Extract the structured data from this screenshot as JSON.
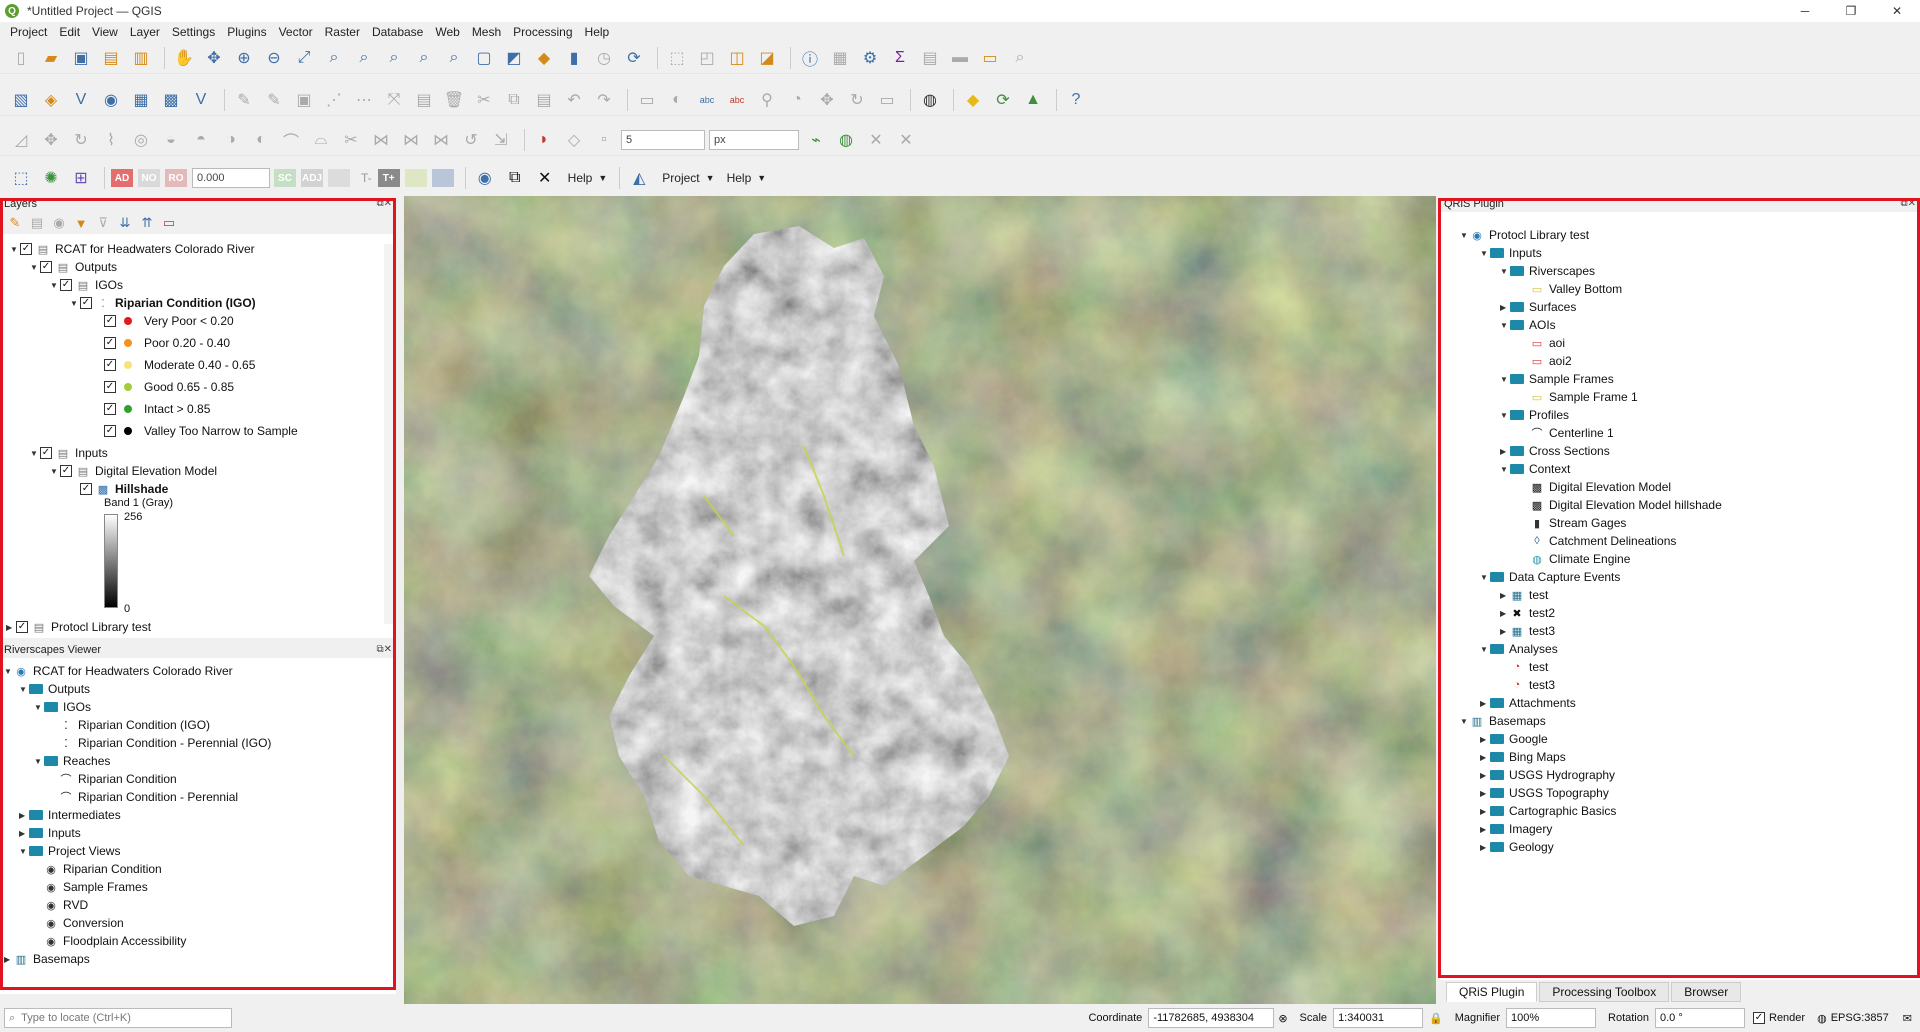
{
  "window": {
    "title": "*Untitled Project — QGIS",
    "app_icon": "qgis-logo-icon",
    "controls": [
      "─",
      "❐",
      "✕"
    ]
  },
  "menu": [
    "Project",
    "Edit",
    "View",
    "Layer",
    "Settings",
    "Plugins",
    "Vector",
    "Raster",
    "Database",
    "Web",
    "Mesh",
    "Processing",
    "Help"
  ],
  "toolbar3": {
    "snap_tolerance": "5",
    "snap_units": "px"
  },
  "toolbar4": {
    "ad": "AD",
    "no": "NO",
    "ro": "RO",
    "value": "0.000",
    "sc": "SC",
    "adj": "ADJ",
    "ht": "T-",
    "tplus": "T+",
    "help1": "Help",
    "project": "Project",
    "help2": "Help"
  },
  "layers_panel": {
    "title": "Layers",
    "items": [
      {
        "label": "RCAT for Headwaters Colorado River",
        "level": 0,
        "expanded": true,
        "checked": true,
        "bold": false
      },
      {
        "label": "Outputs",
        "level": 1,
        "expanded": true,
        "checked": true
      },
      {
        "label": "IGOs",
        "level": 2,
        "expanded": true,
        "checked": true
      },
      {
        "label": "Riparian Condition (IGO)",
        "level": 3,
        "expanded": true,
        "checked": true,
        "bold": true
      },
      {
        "label": "Very Poor < 0.20",
        "color": "#e31a1c"
      },
      {
        "label": "Poor 0.20 - 0.40",
        "color": "#f6921e"
      },
      {
        "label": "Moderate 0.40 - 0.65",
        "color": "#f7e37a"
      },
      {
        "label": "Good 0.65 - 0.85",
        "color": "#a6cc3a"
      },
      {
        "label": "Intact > 0.85",
        "color": "#33a02c"
      },
      {
        "label": "Valley Too Narrow to Sample",
        "color": "#000000"
      },
      {
        "label": "Inputs",
        "level": 1,
        "expanded": true,
        "checked": true
      },
      {
        "label": "Digital Elevation Model",
        "level": 2,
        "expanded": true,
        "checked": true
      },
      {
        "label": "Hillshade",
        "level": 3,
        "checked": true,
        "bold": true
      }
    ],
    "band_label": "Band 1 (Gray)",
    "band_max": "256",
    "band_min": "0",
    "protocol_item": "Protocl Library test"
  },
  "riverscapes_viewer": {
    "title": "Riverscapes Viewer",
    "items": [
      {
        "label": "RCAT for Headwaters Colorado River",
        "level": 0,
        "icon": "globe"
      },
      {
        "label": "Outputs",
        "level": 1,
        "icon": "folder"
      },
      {
        "label": "IGOs",
        "level": 2,
        "icon": "folder"
      },
      {
        "label": "Riparian Condition (IGO)",
        "level": 3,
        "icon": "points"
      },
      {
        "label": "Riparian Condition - Perennial (IGO)",
        "level": 3,
        "icon": "points"
      },
      {
        "label": "Reaches",
        "level": 2,
        "icon": "folder"
      },
      {
        "label": "Riparian Condition",
        "level": 3,
        "icon": "line"
      },
      {
        "label": "Riparian Condition - Perennial",
        "level": 3,
        "icon": "line"
      },
      {
        "label": "Intermediates",
        "level": 1,
        "icon": "folder"
      },
      {
        "label": "Inputs",
        "level": 1,
        "icon": "folder"
      },
      {
        "label": "Project Views",
        "level": 1,
        "icon": "folder"
      },
      {
        "label": "Riparian Condition",
        "level": 2,
        "icon": "eye"
      },
      {
        "label": "Sample Frames",
        "level": 2,
        "icon": "eye"
      },
      {
        "label": "RVD",
        "level": 2,
        "icon": "eye"
      },
      {
        "label": "Conversion",
        "level": 2,
        "icon": "eye"
      },
      {
        "label": "Floodplain Accessibility",
        "level": 2,
        "icon": "eye"
      },
      {
        "label": "Basemaps",
        "level": 0,
        "icon": "book"
      }
    ]
  },
  "qris_panel": {
    "title": "QRiS Plugin",
    "items": [
      {
        "label": "Protocl Library test",
        "level": 0,
        "icon": "globe"
      },
      {
        "label": "Inputs",
        "level": 1,
        "icon": "folder"
      },
      {
        "label": "Riverscapes",
        "level": 2,
        "icon": "folder"
      },
      {
        "label": "Valley Bottom",
        "level": 3,
        "icon": "poly-yellow"
      },
      {
        "label": "Surfaces",
        "level": 2,
        "icon": "folder"
      },
      {
        "label": "AOIs",
        "level": 2,
        "icon": "folder"
      },
      {
        "label": "aoi",
        "level": 3,
        "icon": "poly-red"
      },
      {
        "label": "aoi2",
        "level": 3,
        "icon": "poly-red"
      },
      {
        "label": "Sample Frames",
        "level": 2,
        "icon": "folder"
      },
      {
        "label": "Sample Frame 1",
        "level": 3,
        "icon": "poly-yellow"
      },
      {
        "label": "Profiles",
        "level": 2,
        "icon": "folder"
      },
      {
        "label": "Centerline 1",
        "level": 3,
        "icon": "line"
      },
      {
        "label": "Cross Sections",
        "level": 2,
        "icon": "folder"
      },
      {
        "label": "Context",
        "level": 2,
        "icon": "folder"
      },
      {
        "label": "Digital Elevation Model",
        "level": 3,
        "icon": "raster"
      },
      {
        "label": "Digital Elevation Model hillshade",
        "level": 3,
        "icon": "raster"
      },
      {
        "label": "Stream Gages",
        "level": 3,
        "icon": "gage"
      },
      {
        "label": "Catchment Delineations",
        "level": 3,
        "icon": "drop"
      },
      {
        "label": "Climate Engine",
        "level": 3,
        "icon": "climate"
      },
      {
        "label": "Data Capture Events",
        "level": 1,
        "icon": "folder"
      },
      {
        "label": "test",
        "level": 2,
        "icon": "table"
      },
      {
        "label": "test2",
        "level": 2,
        "icon": "cross"
      },
      {
        "label": "test3",
        "level": 2,
        "icon": "table"
      },
      {
        "label": "Analyses",
        "level": 1,
        "icon": "folder"
      },
      {
        "label": "test",
        "level": 2,
        "icon": "pie"
      },
      {
        "label": "test3",
        "level": 2,
        "icon": "pie"
      },
      {
        "label": "Attachments",
        "level": 1,
        "icon": "folder"
      },
      {
        "label": "Basemaps",
        "level": 0,
        "icon": "book"
      },
      {
        "label": "Google",
        "level": 1,
        "icon": "folder"
      },
      {
        "label": "Bing Maps",
        "level": 1,
        "icon": "folder"
      },
      {
        "label": "USGS Hydrography",
        "level": 1,
        "icon": "folder"
      },
      {
        "label": "USGS Topography",
        "level": 1,
        "icon": "folder"
      },
      {
        "label": "Cartographic Basics",
        "level": 1,
        "icon": "folder"
      },
      {
        "label": "Imagery",
        "level": 1,
        "icon": "folder"
      },
      {
        "label": "Geology",
        "level": 1,
        "icon": "folder"
      }
    ],
    "tabs": [
      "QRiS Plugin",
      "Processing Toolbox",
      "Browser"
    ]
  },
  "status": {
    "locate_placeholder": "Type to locate (Ctrl+K)",
    "coordinate_label": "Coordinate",
    "coordinate": "-11782685, 4938304",
    "scale_label": "Scale",
    "scale": "1:340031",
    "magnifier_label": "Magnifier",
    "magnifier": "100%",
    "rotation_label": "Rotation",
    "rotation": "0.0 °",
    "render_label": "Render",
    "crs": "EPSG:3857"
  }
}
